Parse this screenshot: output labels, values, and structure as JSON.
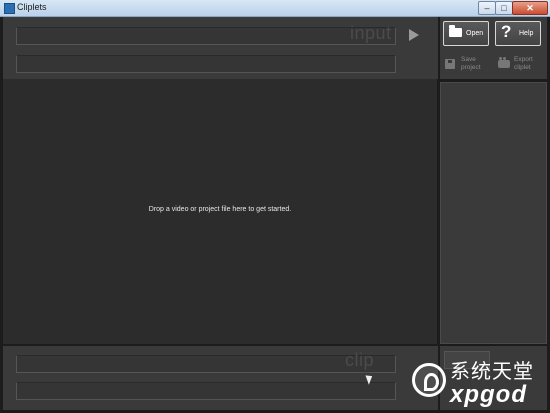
{
  "window": {
    "title": "Cliplets",
    "minimize": "–",
    "maximize": "□",
    "close": "✕"
  },
  "input_panel": {
    "watermark_label": "input"
  },
  "drop_area": {
    "message": "Drop a video or project file here to get started."
  },
  "toolbar": {
    "open_label": "Open",
    "help_label": "Help",
    "help_glyph": "?",
    "save_label": "Save project",
    "export_label": "Export cliplet"
  },
  "bottom_panel": {
    "watermark_label": "clip"
  },
  "watermark": {
    "cn_text": "系统天堂",
    "en_text": "xpgod"
  },
  "colors": {
    "background": "#2c2c2c",
    "panel": "#3a3a3a",
    "button_border": "#d7d7d7"
  }
}
